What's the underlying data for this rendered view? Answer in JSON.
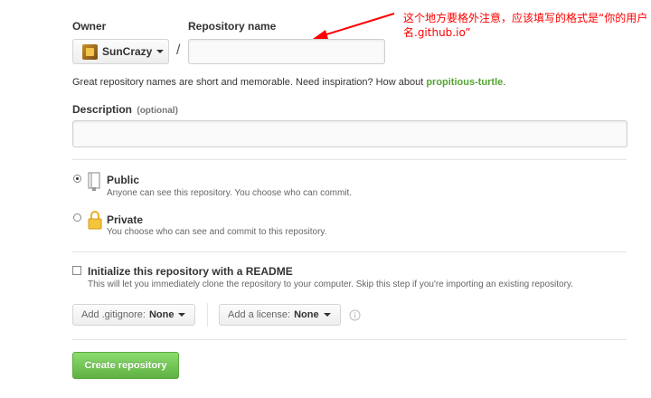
{
  "owner": {
    "label": "Owner",
    "selected": "SunCrazy"
  },
  "repo_name": {
    "label": "Repository name",
    "value": ""
  },
  "separator": "/",
  "annotation": {
    "text": "这个地方要格外注意，应该填写的格式是“你的用户名.github.io”",
    "color": "#ff0000"
  },
  "hint": {
    "text": "Great repository names are short and memorable. Need inspiration? How about ",
    "suggestion": "propitious-turtle",
    "suffix": "."
  },
  "description": {
    "label": "Description",
    "optional": "(optional)",
    "value": ""
  },
  "visibility": {
    "public": {
      "title": "Public",
      "note": "Anyone can see this repository. You choose who can commit.",
      "selected": true,
      "icon": "repo-book-icon"
    },
    "private": {
      "title": "Private",
      "note": "You choose who can see and commit to this repository.",
      "selected": false,
      "icon": "lock-icon"
    }
  },
  "readme": {
    "title": "Initialize this repository with a README",
    "note": "This will let you immediately clone the repository to your computer. Skip this step if you're importing an existing repository.",
    "checked": false
  },
  "gitignore": {
    "prefix": "Add .gitignore:",
    "value": "None"
  },
  "license": {
    "prefix": "Add a license:",
    "value": "None"
  },
  "info_icon": "info-icon",
  "create_button": {
    "label": "Create repository",
    "color": "#6cc644"
  },
  "colors": {
    "suggestion": "#55a532",
    "accent_green": "#60b044"
  }
}
